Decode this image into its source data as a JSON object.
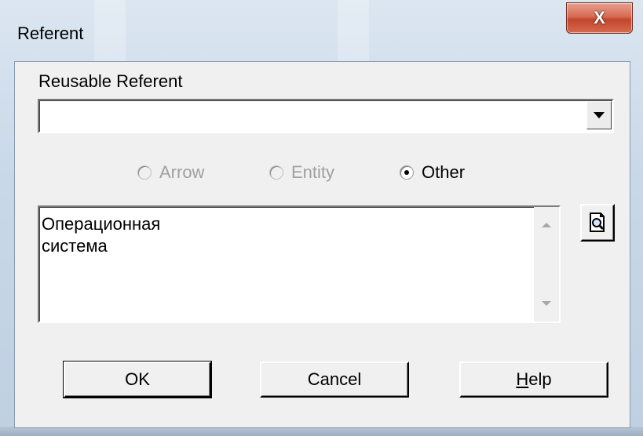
{
  "window": {
    "title": "Referent",
    "close_glyph": "X"
  },
  "reusable": {
    "label": "Reusable Referent",
    "value": ""
  },
  "radios": [
    {
      "label": "Arrow",
      "checked": false,
      "enabled": false
    },
    {
      "label": "Entity",
      "checked": false,
      "enabled": false
    },
    {
      "label": "Other",
      "checked": true,
      "enabled": true
    }
  ],
  "textarea": {
    "value": "Операционная\nсистема"
  },
  "buttons": {
    "ok": "OK",
    "cancel": "Cancel",
    "help_mnemonic": "H",
    "help_rest": "elp"
  },
  "icons": {
    "browse": "magnifier-document-icon",
    "dropdown": "chevron-down-icon",
    "close": "close-icon"
  }
}
